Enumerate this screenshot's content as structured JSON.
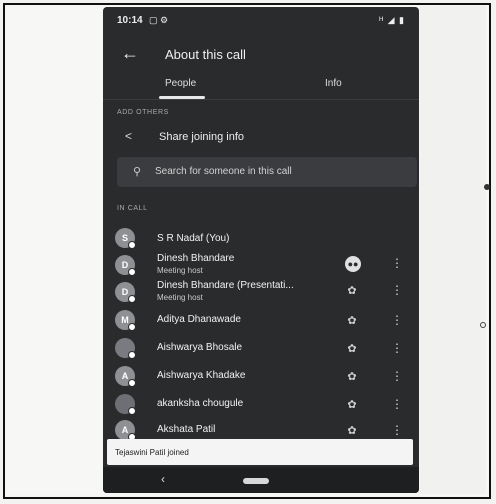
{
  "status_bar": {
    "time": "10:14",
    "notifications": "▢ ⚙",
    "system": "ᴴ ◢ ▮"
  },
  "app_bar": {
    "back_icon": "arrow-back-icon",
    "title": "About this call"
  },
  "tabs": [
    {
      "label": "People",
      "selected": true
    },
    {
      "label": "Info",
      "selected": false
    }
  ],
  "add_others": {
    "section_label": "ADD OTHERS",
    "share_label": "Share joining info",
    "share_icon": "share-icon"
  },
  "search": {
    "placeholder": "Search for someone in this call",
    "icon": "search-icon"
  },
  "in_call": {
    "section_label": "IN CALL",
    "participants": [
      {
        "initial": "S",
        "name": "S R Nadaf (You)",
        "subtitle": "",
        "mic": "none"
      },
      {
        "initial": "D",
        "name": "Dinesh Bhandare",
        "subtitle": "Meeting host",
        "mic": "active"
      },
      {
        "initial": "D",
        "name": "Dinesh Bhandare (Presentati...",
        "subtitle": "Meeting host",
        "mic": "muted"
      },
      {
        "initial": "M",
        "name": "Aditya Dhanawade",
        "subtitle": "",
        "mic": "muted"
      },
      {
        "initial": "",
        "name": "Aishwarya Bhosale",
        "subtitle": "",
        "mic": "muted"
      },
      {
        "initial": "A",
        "name": "Aishwarya Khadake",
        "subtitle": "",
        "mic": "muted"
      },
      {
        "initial": "",
        "name": "akanksha chougule",
        "subtitle": "",
        "mic": "muted"
      },
      {
        "initial": "A",
        "name": "Akshata Patil",
        "subtitle": "",
        "mic": "muted"
      }
    ]
  },
  "snackbar": {
    "message": "Tejaswini Patil joined"
  },
  "colors": {
    "background": "#2a2b2d",
    "surface": "#3b3c3f",
    "text": "#e8e8e8"
  }
}
